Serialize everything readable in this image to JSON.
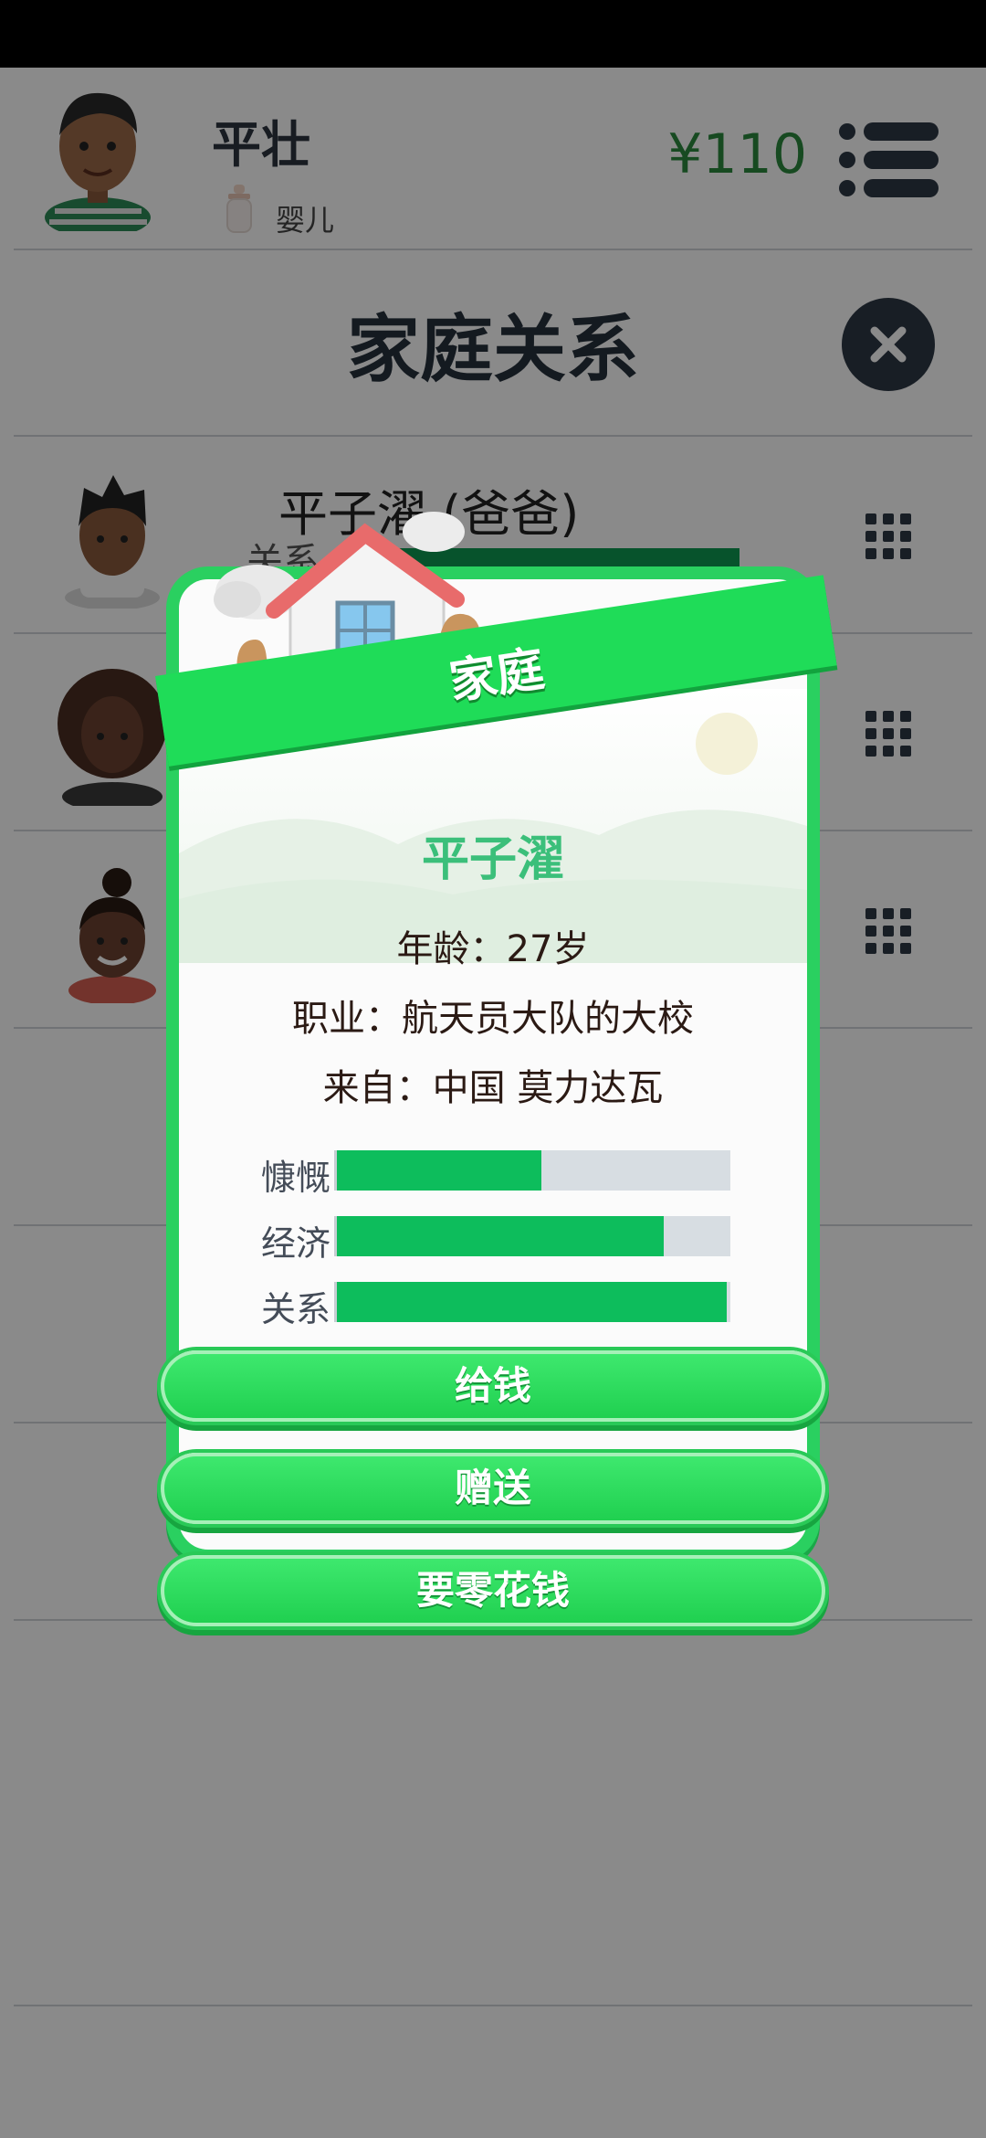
{
  "header": {
    "name": "平壮",
    "stage": "婴儿",
    "money": "¥110"
  },
  "page": {
    "title": "家庭关系"
  },
  "family_rows": [
    {
      "name": "平子濯 (爸爸)",
      "relation_label": "关系"
    },
    {
      "name": "",
      "relation_label": ""
    },
    {
      "name": "",
      "relation_label": ""
    }
  ],
  "modal": {
    "ribbon": "家庭",
    "name": "平子濯",
    "age_line": "年龄：27岁",
    "job_line": "职业：航天员大队的大校",
    "from_line": "来自：中国 莫力达瓦",
    "stats": [
      {
        "label": "慷慨",
        "value": 0.52
      },
      {
        "label": "经济",
        "value": 0.83
      },
      {
        "label": "关系",
        "value": 0.99
      }
    ],
    "buttons": {
      "give_money": "给钱",
      "gift": "赠送",
      "ask_allowance": "要零花钱"
    }
  },
  "colors": {
    "accent_green": "#1fdc58",
    "money_green": "#2b8a3e",
    "name_green": "#3bbf7a",
    "bar_green": "#0dbd5c"
  }
}
